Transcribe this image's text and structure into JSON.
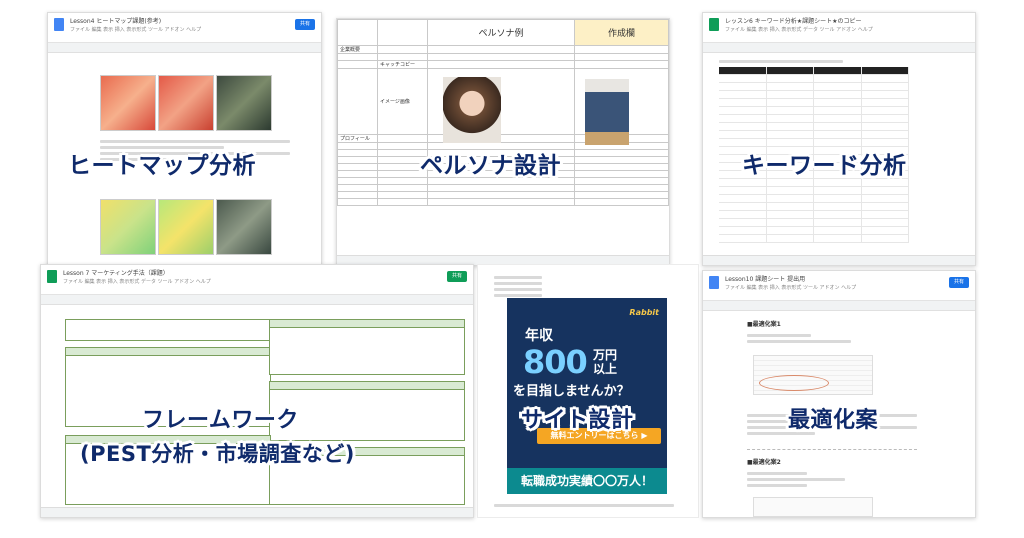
{
  "colors": {
    "label_text": "#0f2a6b",
    "doc_blue": "#4285f4",
    "sheet_green": "#0f9d58",
    "persona_header_bg": "#fdf0c6",
    "banner_bg": "#16335f",
    "banner_cta": "#f5a623",
    "banner_strip": "#0c8a8f"
  },
  "panels": {
    "heatmap": {
      "doc_title": "Lesson4 ヒートマップ課題(参考)",
      "menu": "ファイル 編集 表示 挿入 表示形式 ツール アドオン ヘルプ",
      "label": "ヒートマップ分析",
      "icon": "docs-icon"
    },
    "persona": {
      "header_left": "ペルソナ例",
      "header_right": "作成欄",
      "rows": [
        "企業概要",
        "キャッチコピー",
        "イメージ画像",
        "プロフィール"
      ],
      "label": "ペルソナ設計"
    },
    "keyword": {
      "doc_title": "レッスン6 キーワード分析★課題シート★のコピー",
      "menu": "ファイル 編集 表示 挿入 表示形式 データ ツール アドオン ヘルプ",
      "label": "キーワード分析",
      "icon": "sheets-icon"
    },
    "framework": {
      "doc_title": "Lesson 7 マーケティング手法（課題）",
      "menu": "ファイル 編集 表示 挿入 表示形式 データ ツール アドオン ヘルプ",
      "label_line1": "フレームワーク",
      "label_line2": "(PEST分析・市場調査など)",
      "icon": "sheets-icon"
    },
    "site": {
      "banner_line1": "年収",
      "banner_big": "800",
      "banner_unit1": "万円",
      "banner_unit2": "以上",
      "banner_line2": "を目指しませんか？",
      "cta": "無料エントリーはこちら",
      "strip": "転職成功実績〇〇万人！",
      "label": "サイト設計"
    },
    "optimize": {
      "doc_title": "Lesson10 課題シート 提出用",
      "menu": "ファイル 編集 表示 挿入 表示形式 ツール アドオン ヘルプ",
      "section1": "■最適化案1",
      "section2": "■最適化案2",
      "label": "最適化案",
      "icon": "docs-icon"
    }
  },
  "share_label": "共有"
}
